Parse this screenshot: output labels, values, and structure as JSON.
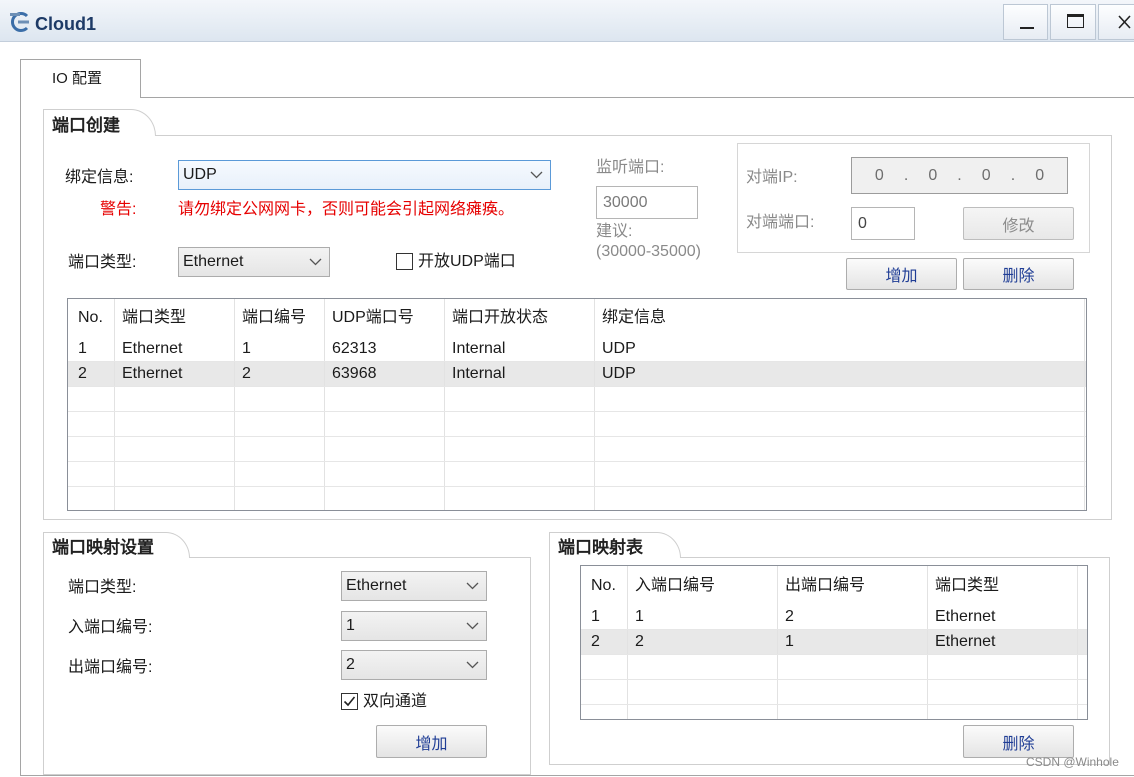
{
  "window": {
    "title": "Cloud1",
    "icon": "cloud-device-icon",
    "controls": [
      "minimize-icon",
      "maximize-icon",
      "close-icon"
    ]
  },
  "tabs": [
    {
      "label": "IO 配置",
      "active": true
    }
  ],
  "port_creation": {
    "title": "端口创建",
    "binding": {
      "label": "绑定信息:",
      "value": "UDP"
    },
    "warning": {
      "label": "警告:",
      "text": "请勿绑定公网网卡，否则可能会引起网络瘫痪。"
    },
    "listen_port": {
      "label": "监听端口:",
      "value": "30000",
      "hint_label": "建议:",
      "hint_range": "(30000-35000)"
    },
    "peer_ip": {
      "label": "对端IP:",
      "octets": [
        "0",
        "0",
        "0",
        "0"
      ],
      "separator": "."
    },
    "peer_port": {
      "label": "对端端口:",
      "value": "0"
    },
    "modify_button": "修改",
    "add_button": "增加",
    "delete_button": "删除",
    "port_type": {
      "label": "端口类型:",
      "value": "Ethernet"
    },
    "open_udp": {
      "label": "开放UDP端口",
      "checked": false
    },
    "table": {
      "columns": [
        "No.",
        "端口类型",
        "端口编号",
        "UDP端口号",
        "端口开放状态",
        "绑定信息"
      ],
      "rows": [
        [
          "1",
          "Ethernet",
          "1",
          "62313",
          "Internal",
          "UDP"
        ],
        [
          "2",
          "Ethernet",
          "2",
          "63968",
          "Internal",
          "UDP"
        ]
      ],
      "selected_row": 2
    }
  },
  "port_mapping_settings": {
    "title": "端口映射设置",
    "port_type": {
      "label": "端口类型:",
      "value": "Ethernet"
    },
    "in_port": {
      "label": "入端口编号:",
      "value": "1"
    },
    "out_port": {
      "label": "出端口编号:",
      "value": "2"
    },
    "bidirectional": {
      "label": "双向通道",
      "checked": true
    },
    "add_button": "增加"
  },
  "port_mapping_table": {
    "title": "端口映射表",
    "columns": [
      "No.",
      "入端口编号",
      "出端口编号",
      "端口类型"
    ],
    "rows": [
      [
        "1",
        "1",
        "2",
        "Ethernet"
      ],
      [
        "2",
        "2",
        "1",
        "Ethernet"
      ]
    ],
    "selected_row": 2,
    "delete_button": "删除"
  },
  "watermark": "CSDN @Winhole",
  "colors": {
    "button_text": "#1f3d95",
    "warning": "#e60000",
    "disabled_text": "#8a8a8a",
    "selected_row": "#e8e8e8",
    "focus_border": "#5b9ad8"
  }
}
